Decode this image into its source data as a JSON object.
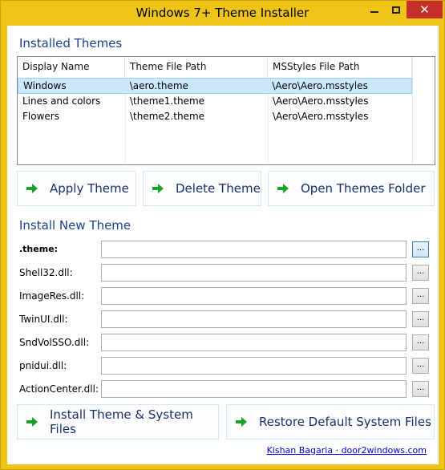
{
  "window": {
    "title": "Windows 7+ Theme Installer",
    "close_glyph": "✕"
  },
  "installed": {
    "section_title": "Installed Themes",
    "columns": [
      "Display Name",
      "Theme File Path",
      "MSStyles File Path"
    ],
    "rows": [
      {
        "name": "Windows",
        "theme_path": "\\aero.theme",
        "msstyles_path": "\\Aero\\Aero.msstyles",
        "selected": true
      },
      {
        "name": "Lines and colors",
        "theme_path": "\\theme1.theme",
        "msstyles_path": "\\Aero\\Aero.msstyles",
        "selected": false
      },
      {
        "name": "Flowers",
        "theme_path": "\\theme2.theme",
        "msstyles_path": "\\Aero\\Aero.msstyles",
        "selected": false
      }
    ]
  },
  "actions": {
    "apply": "Apply Theme",
    "delete": "Delete Theme",
    "open_folder": "Open Themes Folder",
    "arrow_icon": "green-arrow-icon"
  },
  "install": {
    "section_title": "Install New Theme",
    "fields": [
      {
        "label": ".theme:",
        "value": ""
      },
      {
        "label": "Shell32.dll:",
        "value": ""
      },
      {
        "label": "ImageRes.dll:",
        "value": ""
      },
      {
        "label": "TwinUI.dll:",
        "value": ""
      },
      {
        "label": "SndVolSSO.dll:",
        "value": ""
      },
      {
        "label": "pnidui.dll:",
        "value": ""
      },
      {
        "label": "ActionCenter.dll:",
        "value": ""
      }
    ],
    "browse_label": "...",
    "install_button": "Install Theme & System Files",
    "restore_button": "Restore Default System Files"
  },
  "footer": {
    "link_text": "Kishan Bagaria · door2windows.com"
  },
  "colors": {
    "frame": "#f0c419",
    "accent_text": "#1e3f8f",
    "selection": "#cce8ff",
    "close": "#c7302a",
    "arrow": "#1aa128"
  }
}
